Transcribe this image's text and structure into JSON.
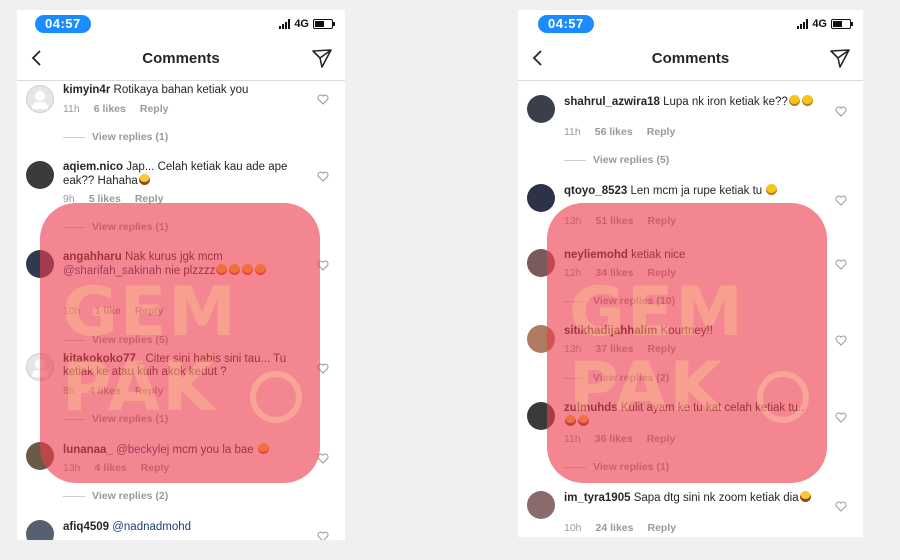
{
  "left": {
    "status": {
      "time": "04:57",
      "network": "4G"
    },
    "header": {
      "title": "Comments"
    },
    "comments": [
      {
        "username": "kimyin4r",
        "text": "Rotikaya bahan ketiak you",
        "time": "11h",
        "likes": "6 likes",
        "reply": "Reply",
        "view_replies": "View replies (1)"
      },
      {
        "username": "aqiem.nico",
        "text": "Jap... Celah ketiak kau ade ape eak?? Hahaha",
        "time": "9h",
        "likes": "5 likes",
        "reply": "Reply",
        "view_replies": "View replies (1)"
      },
      {
        "username": "angahharu",
        "text": "Nak kurus jgk mcm",
        "mention": "@sharifah_sakinah",
        "text2": "nie plzzzz",
        "time": "10h",
        "likes": "1 like",
        "reply": "Reply",
        "view_replies": "View replies (5)"
      },
      {
        "username": "kitakokoko77_",
        "text": "Citer sini habis sini tau... Tu ketiak ke atau kuih akok kedut ?",
        "time": "8h",
        "likes": "4 likes",
        "reply": "Reply",
        "view_replies": "View replies (1)"
      },
      {
        "username": "lunanaa_",
        "mention": "@beckylej",
        "text": "mcm you la bae",
        "time": "13h",
        "likes": "4 likes",
        "reply": "Reply",
        "view_replies": "View replies (2)"
      },
      {
        "username": "afiq4509",
        "mention": "@nadnadmohd"
      }
    ]
  },
  "right": {
    "status": {
      "time": "04:57",
      "network": "4G"
    },
    "header": {
      "title": "Comments"
    },
    "comments": [
      {
        "username": "shahrul_azwira18",
        "text": "Lupa nk iron ketiak ke??",
        "time": "11h",
        "likes": "56 likes",
        "reply": "Reply",
        "view_replies": "View replies (5)"
      },
      {
        "username": "qtoyo_8523",
        "text": "Len mcm ja rupe ketiak tu",
        "time": "13h",
        "likes": "51 likes",
        "reply": "Reply"
      },
      {
        "username": "neyliemohd",
        "text": "ketiak nice",
        "time": "12h",
        "likes": "34 likes",
        "reply": "Reply",
        "view_replies": "View replies (10)"
      },
      {
        "username": "sitikhadijahhalim",
        "text": "Kourtney!!",
        "time": "13h",
        "likes": "37 likes",
        "reply": "Reply",
        "view_replies": "View replies (2)"
      },
      {
        "username": "zulmuhds",
        "text": "Kulit ayam ke tu kat celah ketiak tu..",
        "time": "11h",
        "likes": "36 likes",
        "reply": "Reply",
        "view_replies": "View replies (1)"
      },
      {
        "username": "im_tyra1905",
        "text": "Sapa dtg sini nk zoom ketiak dia",
        "time": "10h",
        "likes": "24 likes",
        "reply": "Reply"
      }
    ]
  },
  "watermark": {
    "line1": "GEM",
    "line2": "PAK"
  }
}
